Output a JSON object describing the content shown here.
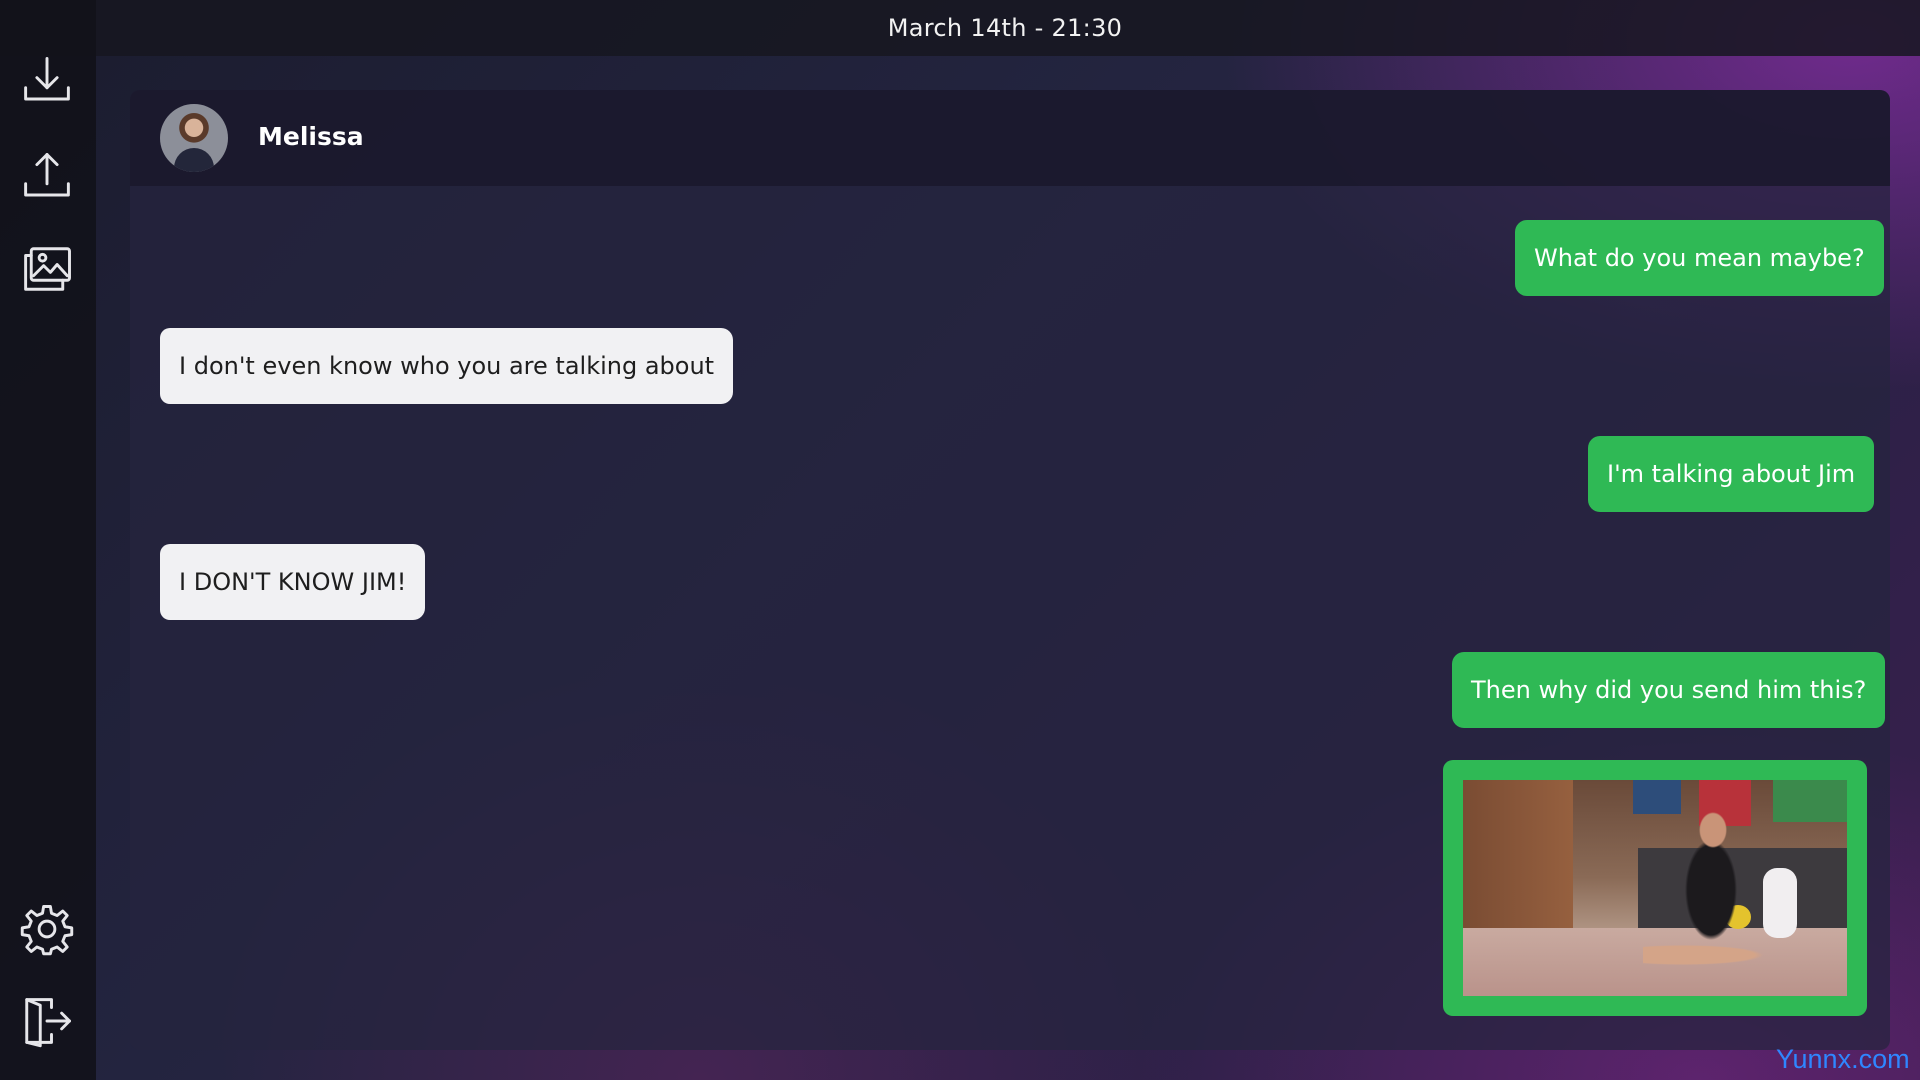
{
  "topbar": {
    "datetime": "March 14th - 21:30"
  },
  "sidebar": {
    "items": [
      {
        "icon": "download-icon"
      },
      {
        "icon": "upload-icon"
      },
      {
        "icon": "gallery-icon"
      },
      {
        "icon": "gear-icon"
      },
      {
        "icon": "exit-icon"
      }
    ]
  },
  "chat": {
    "contact": {
      "name": "Melissa"
    },
    "messages": [
      {
        "side": "out",
        "text": "What do you mean maybe?"
      },
      {
        "side": "in",
        "text": "I don't even know who you are talking about"
      },
      {
        "side": "out",
        "text": "I'm talking about Jim"
      },
      {
        "side": "in",
        "text": "I DON'T KNOW JIM!"
      },
      {
        "side": "out",
        "text": "Then why did you send him this?"
      },
      {
        "side": "out",
        "type": "image"
      }
    ]
  },
  "watermark": "Yunnx.com",
  "colors": {
    "outgoing_bubble": "#2fb955",
    "incoming_bubble": "#f1f1f3"
  }
}
